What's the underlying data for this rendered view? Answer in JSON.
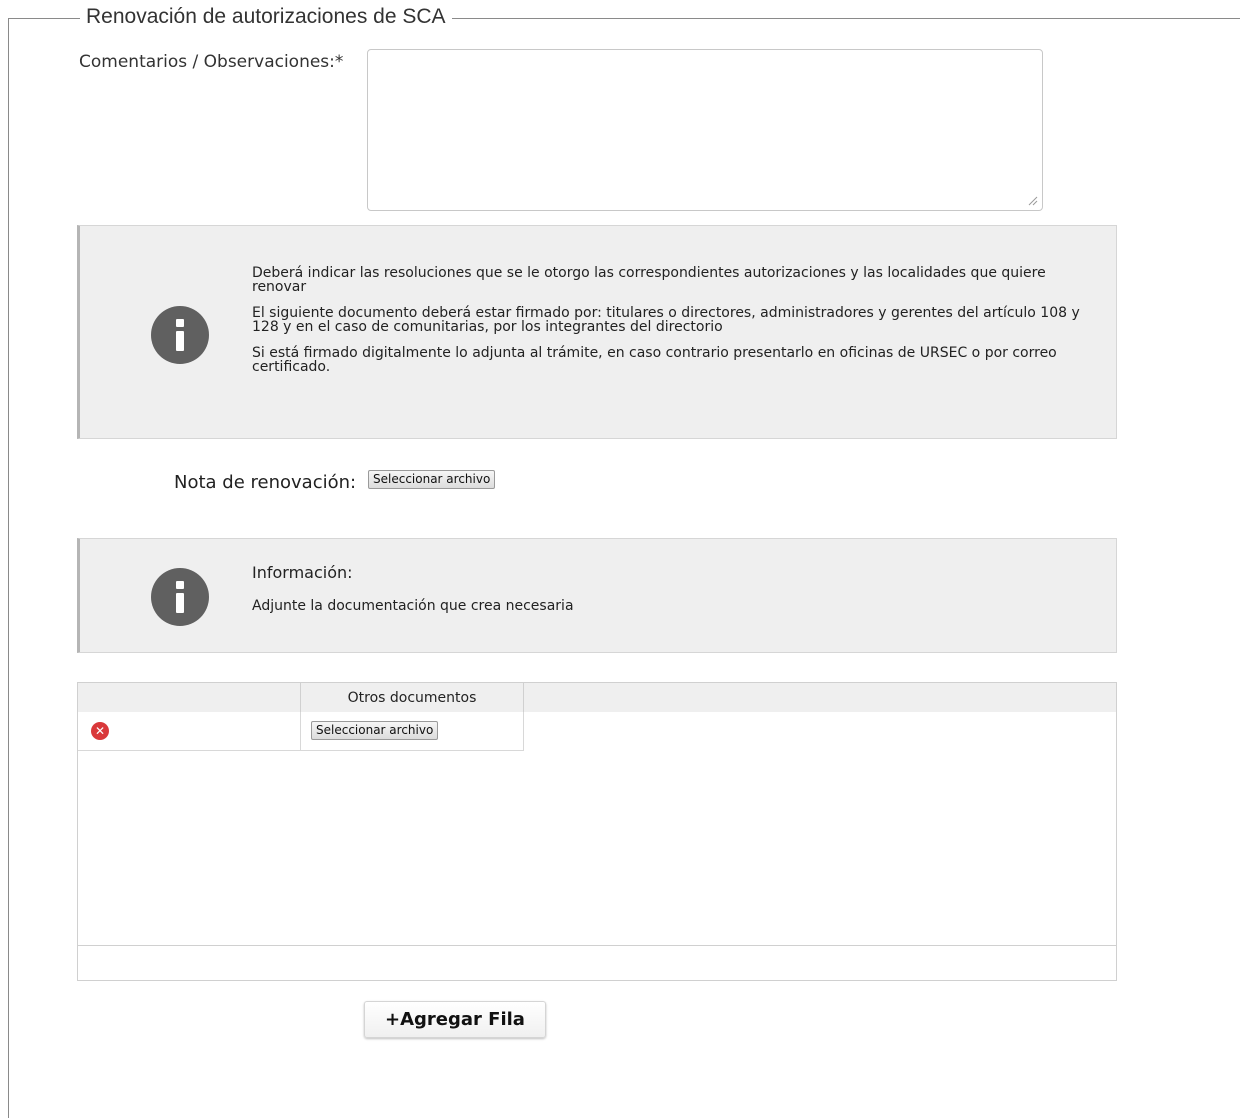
{
  "form": {
    "legend": "Renovación de autorizaciones de SCA",
    "comments_label": "Comentarios / Observaciones:*",
    "comments_value": ""
  },
  "info_box_1": {
    "paragraphs": [
      "Deberá indicar las resoluciones que se le otorgo las correspondientes autorizaciones y las localidades que quiere renovar",
      "El siguiente documento deberá estar firmado por: titulares o  directores, administradores y gerentes del artículo 108 y 128 y en el caso de comunitarias, por los integrantes del directorio",
      "Si está firmado digitalmente lo adjunta al trámite, en caso contrario presentarlo en oficinas de URSEC o por correo certificado."
    ],
    "icon": "info-icon"
  },
  "nota": {
    "label": "Nota de renovación:",
    "file_button": "Seleccionar archivo"
  },
  "info_box_2": {
    "title": "Información:",
    "text": "Adjunte la documentación que crea necesaria",
    "icon": "info-icon"
  },
  "grid": {
    "columns": [
      "",
      "Otros documentos"
    ],
    "rows": [
      {
        "delete_icon": "delete-icon",
        "file_button": "Seleccionar archivo"
      }
    ]
  },
  "actions": {
    "add_row": "+Agregar Fila"
  },
  "colors": {
    "info_bg": "#efefef",
    "icon_gray": "#606060",
    "delete_red": "#d9383a"
  }
}
